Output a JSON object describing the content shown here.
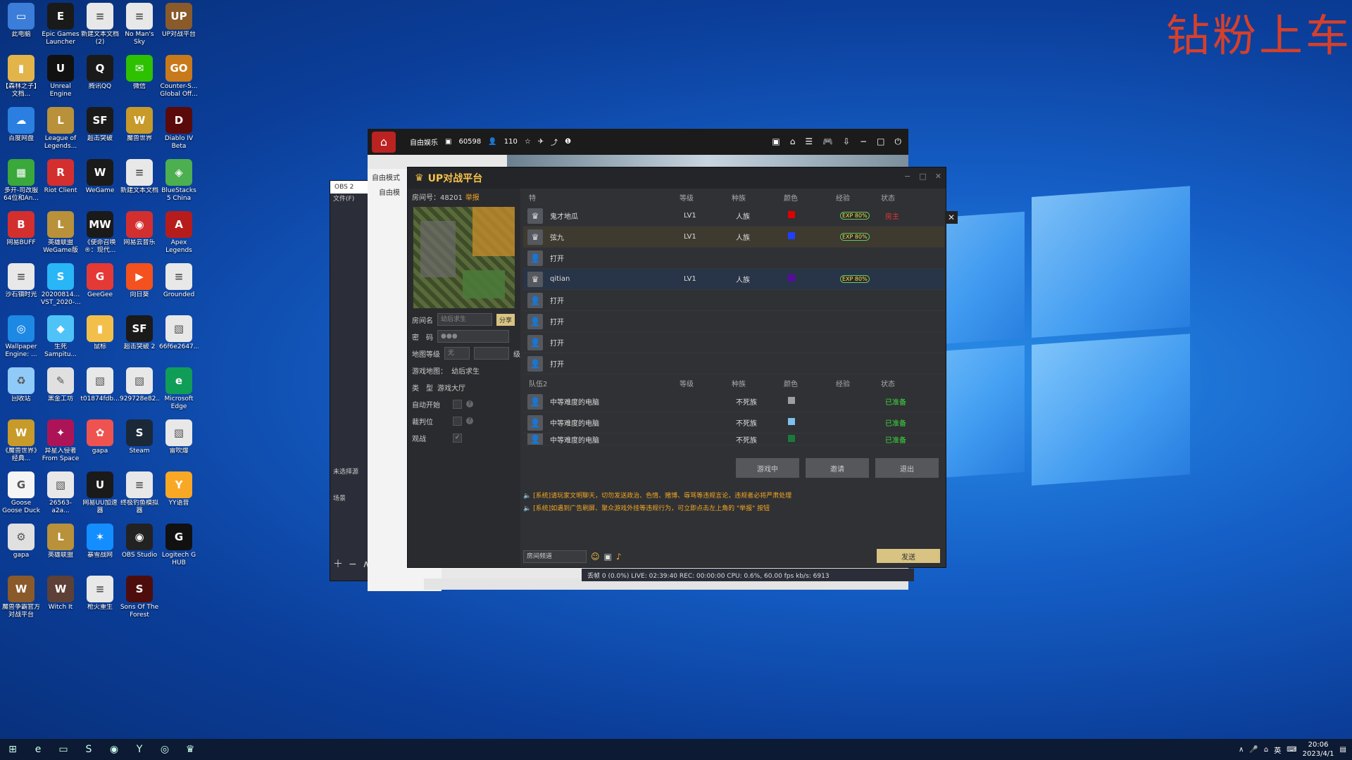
{
  "watermark": "钻粉上车",
  "desktop_icons": [
    {
      "label": "此电脑",
      "icon": "computer-icon",
      "color": "#3b7dd8",
      "glyph": "▭"
    },
    {
      "label": "Epic Games Launcher",
      "icon": "epic-icon",
      "color": "#1a1a1a",
      "glyph": "E"
    },
    {
      "label": "新建文本文档 (2)",
      "icon": "text-file-icon",
      "color": "#e8e8e8",
      "glyph": "≡"
    },
    {
      "label": "No Man's Sky",
      "icon": "file-icon",
      "color": "#e8e8e8",
      "glyph": "≡"
    },
    {
      "label": "UP对战平台",
      "icon": "up-platform-icon",
      "color": "#8a5a2a",
      "glyph": "UP"
    },
    {
      "label": "【森林之子】 文档...",
      "icon": "archive-icon",
      "color": "#e2b44a",
      "glyph": "▮"
    },
    {
      "label": "Unreal Engine",
      "icon": "unreal-icon",
      "color": "#111",
      "glyph": "U"
    },
    {
      "label": "腾讯QQ",
      "icon": "qq-icon",
      "color": "#1a1a1a",
      "glyph": "Q"
    },
    {
      "label": "微信",
      "icon": "wechat-icon",
      "color": "#2dc100",
      "glyph": "✉"
    },
    {
      "label": "Counter-S... Global Off...",
      "icon": "csgo-icon",
      "color": "#c87a1a",
      "glyph": "GO"
    },
    {
      "label": "百度网盘",
      "icon": "baidu-icon",
      "color": "#2a7fe0",
      "glyph": "☁"
    },
    {
      "label": "League of Legends...",
      "icon": "lol-icon",
      "color": "#b8913a",
      "glyph": "L"
    },
    {
      "label": "超击突破",
      "icon": "game-icon",
      "color": "#1a1a1a",
      "glyph": "SF"
    },
    {
      "label": "魔兽世界",
      "icon": "wow-icon",
      "color": "#c79a2a",
      "glyph": "W"
    },
    {
      "label": "Diablo IV Beta",
      "icon": "diablo-icon",
      "color": "#5a0a0a",
      "glyph": "D"
    },
    {
      "label": "多开-司改服 64位和An...",
      "icon": "green-app-icon",
      "color": "#3aa83a",
      "glyph": "▦"
    },
    {
      "label": "Riot Client",
      "icon": "riot-icon",
      "color": "#d32f2f",
      "glyph": "R"
    },
    {
      "label": "WeGame",
      "icon": "wegame-icon",
      "color": "#1a1a1a",
      "glyph": "W"
    },
    {
      "label": "新建文本文档",
      "icon": "text-file-icon",
      "color": "#e8e8e8",
      "glyph": "≡"
    },
    {
      "label": "BlueStacks 5 China",
      "icon": "bluestacks-icon",
      "color": "#4caf50",
      "glyph": "◈"
    },
    {
      "label": "网易BUFF",
      "icon": "buff-icon",
      "color": "#d32f2f",
      "glyph": "B"
    },
    {
      "label": "英雄联盟 WeGame版",
      "icon": "lol-icon",
      "color": "#b8913a",
      "glyph": "L"
    },
    {
      "label": "《使命召唤 ®：现代...",
      "icon": "cod-icon",
      "color": "#1a1a1a",
      "glyph": "MW"
    },
    {
      "label": "网易云音乐",
      "icon": "netease-music-icon",
      "color": "#d32f2f",
      "glyph": "◉"
    },
    {
      "label": "Apex Legends",
      "icon": "apex-icon",
      "color": "#b71c1c",
      "glyph": "A"
    },
    {
      "label": "沙石镇时光",
      "icon": "file-icon",
      "color": "#e8e8e8",
      "glyph": "≡"
    },
    {
      "label": "20200814... VST_2020-...",
      "icon": "s-app-icon",
      "color": "#29b6f6",
      "glyph": "S"
    },
    {
      "label": "GeeGee",
      "icon": "geegee-icon",
      "color": "#e53935",
      "glyph": "G"
    },
    {
      "label": "向日葵",
      "icon": "sunflower-icon",
      "color": "#f4511e",
      "glyph": "▶"
    },
    {
      "label": "Grounded",
      "icon": "file-icon",
      "color": "#e8e8e8",
      "glyph": "≡"
    },
    {
      "label": "Wallpaper Engine: ...",
      "icon": "wallpaper-icon",
      "color": "#1e88e5",
      "glyph": "◎"
    },
    {
      "label": "生死 Sampitu...",
      "icon": "app-icon",
      "color": "#4fc3f7",
      "glyph": "◆"
    },
    {
      "label": "鼠标",
      "icon": "folder-icon",
      "color": "#f2c04a",
      "glyph": "▮"
    },
    {
      "label": "超击突破 2",
      "icon": "game-icon",
      "color": "#1a1a1a",
      "glyph": "SF"
    },
    {
      "label": "66f6e2647...",
      "icon": "image-icon",
      "color": "#e8e8e8",
      "glyph": "▧"
    },
    {
      "label": "回收站",
      "icon": "recycle-bin-icon",
      "color": "#90caf9",
      "glyph": "♻"
    },
    {
      "label": "黑金工坊",
      "icon": "tool-icon",
      "color": "#e0e0e0",
      "glyph": "✎"
    },
    {
      "label": "t01874fdb...",
      "icon": "image-icon",
      "color": "#e8e8e8",
      "glyph": "▧"
    },
    {
      "label": "929728e82...",
      "icon": "image-icon",
      "color": "#e8e8e8",
      "glyph": "▧"
    },
    {
      "label": "Microsoft Edge",
      "icon": "edge-icon",
      "color": "#0f9d58",
      "glyph": "e"
    },
    {
      "label": "《魔兽世界》经典...",
      "icon": "wow-icon",
      "color": "#c79a2a",
      "glyph": "W"
    },
    {
      "label": "异星入侵者 From Space",
      "icon": "game-icon",
      "color": "#ad1457",
      "glyph": "✦"
    },
    {
      "label": "gapa",
      "icon": "gapa-icon",
      "color": "#ef5350",
      "glyph": "✿"
    },
    {
      "label": "Steam",
      "icon": "steam-icon",
      "color": "#1b2838",
      "glyph": "S"
    },
    {
      "label": "雷吹爆",
      "icon": "image-icon",
      "color": "#e8e8e8",
      "glyph": "▧"
    },
    {
      "label": "Goose Goose Duck",
      "icon": "goose-icon",
      "color": "#f5f5f5",
      "glyph": "G"
    },
    {
      "label": "26563-a2a...",
      "icon": "image-icon",
      "color": "#e8e8e8",
      "glyph": "▧"
    },
    {
      "label": "网易UU加速器",
      "icon": "uu-icon",
      "color": "#1a1a1a",
      "glyph": "U"
    },
    {
      "label": "终极钓鱼模拟器",
      "icon": "file-icon",
      "color": "#e8e8e8",
      "glyph": "≡"
    },
    {
      "label": "YY语音",
      "icon": "yy-icon",
      "color": "#f9a825",
      "glyph": "Y"
    },
    {
      "label": "gapa",
      "icon": "gear-icon",
      "color": "#e0e0e0",
      "glyph": "⚙"
    },
    {
      "label": "英雄联盟",
      "icon": "lol-icon",
      "color": "#b8913a",
      "glyph": "L"
    },
    {
      "label": "暴雪战网",
      "icon": "battlenet-icon",
      "color": "#148eff",
      "glyph": "✶"
    },
    {
      "label": "OBS Studio",
      "icon": "obs-icon",
      "color": "#222",
      "glyph": "◉"
    },
    {
      "label": "Logitech G HUB",
      "icon": "logitech-icon",
      "color": "#111",
      "glyph": "G"
    },
    {
      "label": "魔兽争霸官方对战平台",
      "icon": "warcraft-icon",
      "color": "#8a5a2a",
      "glyph": "W"
    },
    {
      "label": "Witch It",
      "icon": "witchit-icon",
      "color": "#5d4037",
      "glyph": "W"
    },
    {
      "label": "枪火重生",
      "icon": "file-icon",
      "color": "#e8e8e8",
      "glyph": "≡"
    },
    {
      "label": "Sons Of The Forest",
      "icon": "sotf-icon",
      "color": "#4e0d0d",
      "glyph": "S"
    }
  ],
  "client": {
    "mode": "自由娱乐",
    "coins": "60598",
    "users": "110",
    "tree_header": "自由模式",
    "tree_first": "自由模"
  },
  "obs": {
    "title": "OBS 2",
    "menu": "文件(F)",
    "no_source": "未选择源",
    "scenes_label": "场景",
    "scenes_tab": "场景",
    "status": "丢帧 0 (0.0%)   LIVE: 02:39:40   REC: 00:00:00   CPU: 0.6%, 60.00 fps   kb/s: 6913"
  },
  "up": {
    "title": "UP对战平台",
    "room_no_label": "房间号：48201",
    "report": "举报",
    "room_name_label": "房间名",
    "room_name_value": "幼后求生",
    "share_btn": "分享",
    "password_label": "密　码",
    "password_value": "●●●",
    "map_level_label": "地图等级",
    "map_level_value": "无",
    "level_unit": "级",
    "game_map_label": "游戏地图：",
    "game_map_value": "幼后求生",
    "type_label": "类　型",
    "type_value": "游戏大厅",
    "auto_start_label": "自动开始",
    "referee_label": "裁判位",
    "spectate_label": "观战",
    "team1_header": "特",
    "cols": {
      "level": "等级",
      "race": "种族",
      "color": "颜色",
      "exp": "经验",
      "status": "状态"
    },
    "team1": [
      {
        "name": "鬼才地瓜",
        "level": "LV1",
        "race": "人族",
        "color": "#e00000",
        "exp": "EXP 80%",
        "status": "房主",
        "open": false
      },
      {
        "name": "弦九",
        "level": "LV1",
        "race": "人族",
        "color": "#1e40ff",
        "exp": "EXP 80%",
        "status": "",
        "open": false
      },
      {
        "name": "打开",
        "level": "",
        "race": "",
        "color": "",
        "exp": "",
        "status": "",
        "open": true
      },
      {
        "name": "qitian",
        "level": "LV1",
        "race": "人族",
        "color": "#5a0aa0",
        "exp": "EXP 80%",
        "status": "",
        "open": false
      },
      {
        "name": "打开",
        "level": "",
        "race": "",
        "color": "",
        "exp": "",
        "status": "",
        "open": true
      },
      {
        "name": "打开",
        "level": "",
        "race": "",
        "color": "",
        "exp": "",
        "status": "",
        "open": true
      },
      {
        "name": "打开",
        "level": "",
        "race": "",
        "color": "",
        "exp": "",
        "status": "",
        "open": true
      },
      {
        "name": "打开",
        "level": "",
        "race": "",
        "color": "",
        "exp": "",
        "status": "",
        "open": true
      }
    ],
    "team2_header": "队伍2",
    "team2": [
      {
        "name": "中等难度的电脑",
        "race": "不死族",
        "color": "#9e9e9e",
        "status": "已准备"
      },
      {
        "name": "中等难度的电脑",
        "race": "不死族",
        "color": "#7ec0ee",
        "status": "已准备"
      },
      {
        "name": "中等难度的电脑",
        "race": "不死族",
        "color": "#1a7a3a",
        "status": "已准备"
      }
    ],
    "btn_ingame": "游戏中",
    "btn_invite": "邀请",
    "btn_exit": "退出",
    "messages": [
      "[系统]请玩家文明聊天，切勿发送政治、色情、赌博、辱骂等违规言论，违规者必将严肃处理",
      "[系统]如遇到广告刷屏、聚众游戏外挂等违规行为，可立即点击左上角的 \"举报\" 按钮"
    ],
    "channel": "房间频道",
    "send": "发送"
  },
  "taskbar": {
    "ime": "英",
    "time": "20:06",
    "date": "2023/4/1"
  }
}
